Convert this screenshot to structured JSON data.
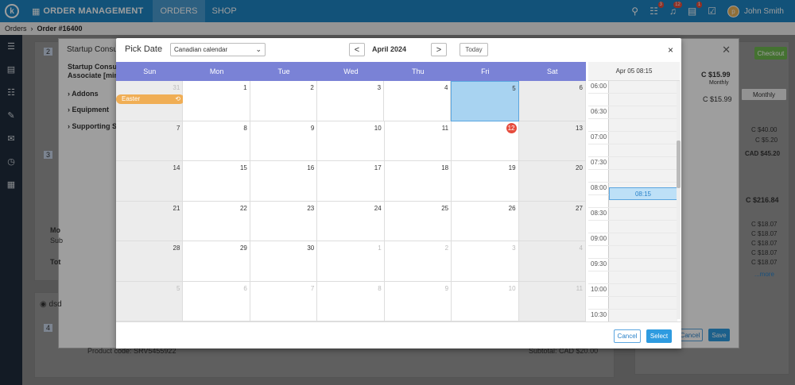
{
  "topbar": {
    "logo": "k",
    "module": "ORDER MANAGEMENT",
    "tabs": [
      {
        "label": "ORDERS",
        "active": true
      },
      {
        "label": "SHOP",
        "active": false
      }
    ],
    "badges": {
      "cart": "3",
      "bell": "12",
      "orders": "1"
    },
    "user": {
      "initial": "p",
      "name": "John Smith"
    }
  },
  "breadcrumb": {
    "root": "Orders",
    "current": "Order #16400"
  },
  "background": {
    "step2": "2",
    "product_title": "Startup Consu",
    "product_name": "Startup Consu",
    "product_name2": "Associate [min 3",
    "sections": [
      "Addons",
      "Equipment",
      "Supporting Se"
    ],
    "step3": "3",
    "mo": "Mo",
    "sub": "Sub",
    "tot": "Tot",
    "location": "dsd",
    "step4": "4",
    "product_code_label": "Product code:",
    "product_code": "SRV5455922",
    "subtotal_label": "Subtotal:",
    "subtotal": "CAD $20.00",
    "checkout": "Checkout",
    "price_top": "C $15.99",
    "price_top_period": "Monthly",
    "price_mid": "C $15.99",
    "monthly_tab": "Monthly",
    "prices_a": [
      "C $40.00",
      "C $5.20"
    ],
    "total_a": "CAD $45.20",
    "price_b": "C $216.84",
    "prices_b": [
      "C $18.07",
      "C $18.07",
      "C $18.07",
      "C $18.07",
      "C $18.07"
    ],
    "more": "...more",
    "cancel": "Cancel",
    "save": "Save"
  },
  "datepicker": {
    "title": "Pick Date",
    "calendar": "Canadian calendar",
    "month": "April 2024",
    "prev": "<",
    "next": ">",
    "today": "Today",
    "close": "×",
    "weekdays": [
      "Sun",
      "Mon",
      "Tue",
      "Wed",
      "Thu",
      "Fri",
      "Sat"
    ],
    "weeks": [
      [
        {
          "d": "31",
          "o": true
        },
        {
          "d": "1"
        },
        {
          "d": "2"
        },
        {
          "d": "3"
        },
        {
          "d": "4"
        },
        {
          "d": "5",
          "sel": true
        },
        {
          "d": "6"
        }
      ],
      [
        {
          "d": "7"
        },
        {
          "d": "8"
        },
        {
          "d": "9"
        },
        {
          "d": "10"
        },
        {
          "d": "11"
        },
        {
          "d": "12",
          "today": true
        },
        {
          "d": "13"
        }
      ],
      [
        {
          "d": "14"
        },
        {
          "d": "15"
        },
        {
          "d": "16"
        },
        {
          "d": "17"
        },
        {
          "d": "18"
        },
        {
          "d": "19"
        },
        {
          "d": "20"
        }
      ],
      [
        {
          "d": "21"
        },
        {
          "d": "22"
        },
        {
          "d": "23"
        },
        {
          "d": "24"
        },
        {
          "d": "25"
        },
        {
          "d": "26"
        },
        {
          "d": "27"
        }
      ],
      [
        {
          "d": "28"
        },
        {
          "d": "29"
        },
        {
          "d": "30"
        },
        {
          "d": "1",
          "o": true
        },
        {
          "d": "2",
          "o": true
        },
        {
          "d": "3",
          "o": true
        },
        {
          "d": "4",
          "o": true
        }
      ],
      [
        {
          "d": "5",
          "o": true
        },
        {
          "d": "6",
          "o": true
        },
        {
          "d": "7",
          "o": true
        },
        {
          "d": "8",
          "o": true
        },
        {
          "d": "9",
          "o": true
        },
        {
          "d": "10",
          "o": true
        },
        {
          "d": "11",
          "o": true
        }
      ]
    ],
    "event": {
      "label": "Easter",
      "icon": "⟲"
    },
    "time_header": "Apr 05 08:15",
    "times": [
      "06:00",
      "06:30",
      "07:00",
      "07:30",
      "08:00",
      "08:30",
      "09:00",
      "09:30",
      "10:00",
      "10:30"
    ],
    "selected_time": "08:15",
    "cancel": "Cancel",
    "select": "Select"
  }
}
